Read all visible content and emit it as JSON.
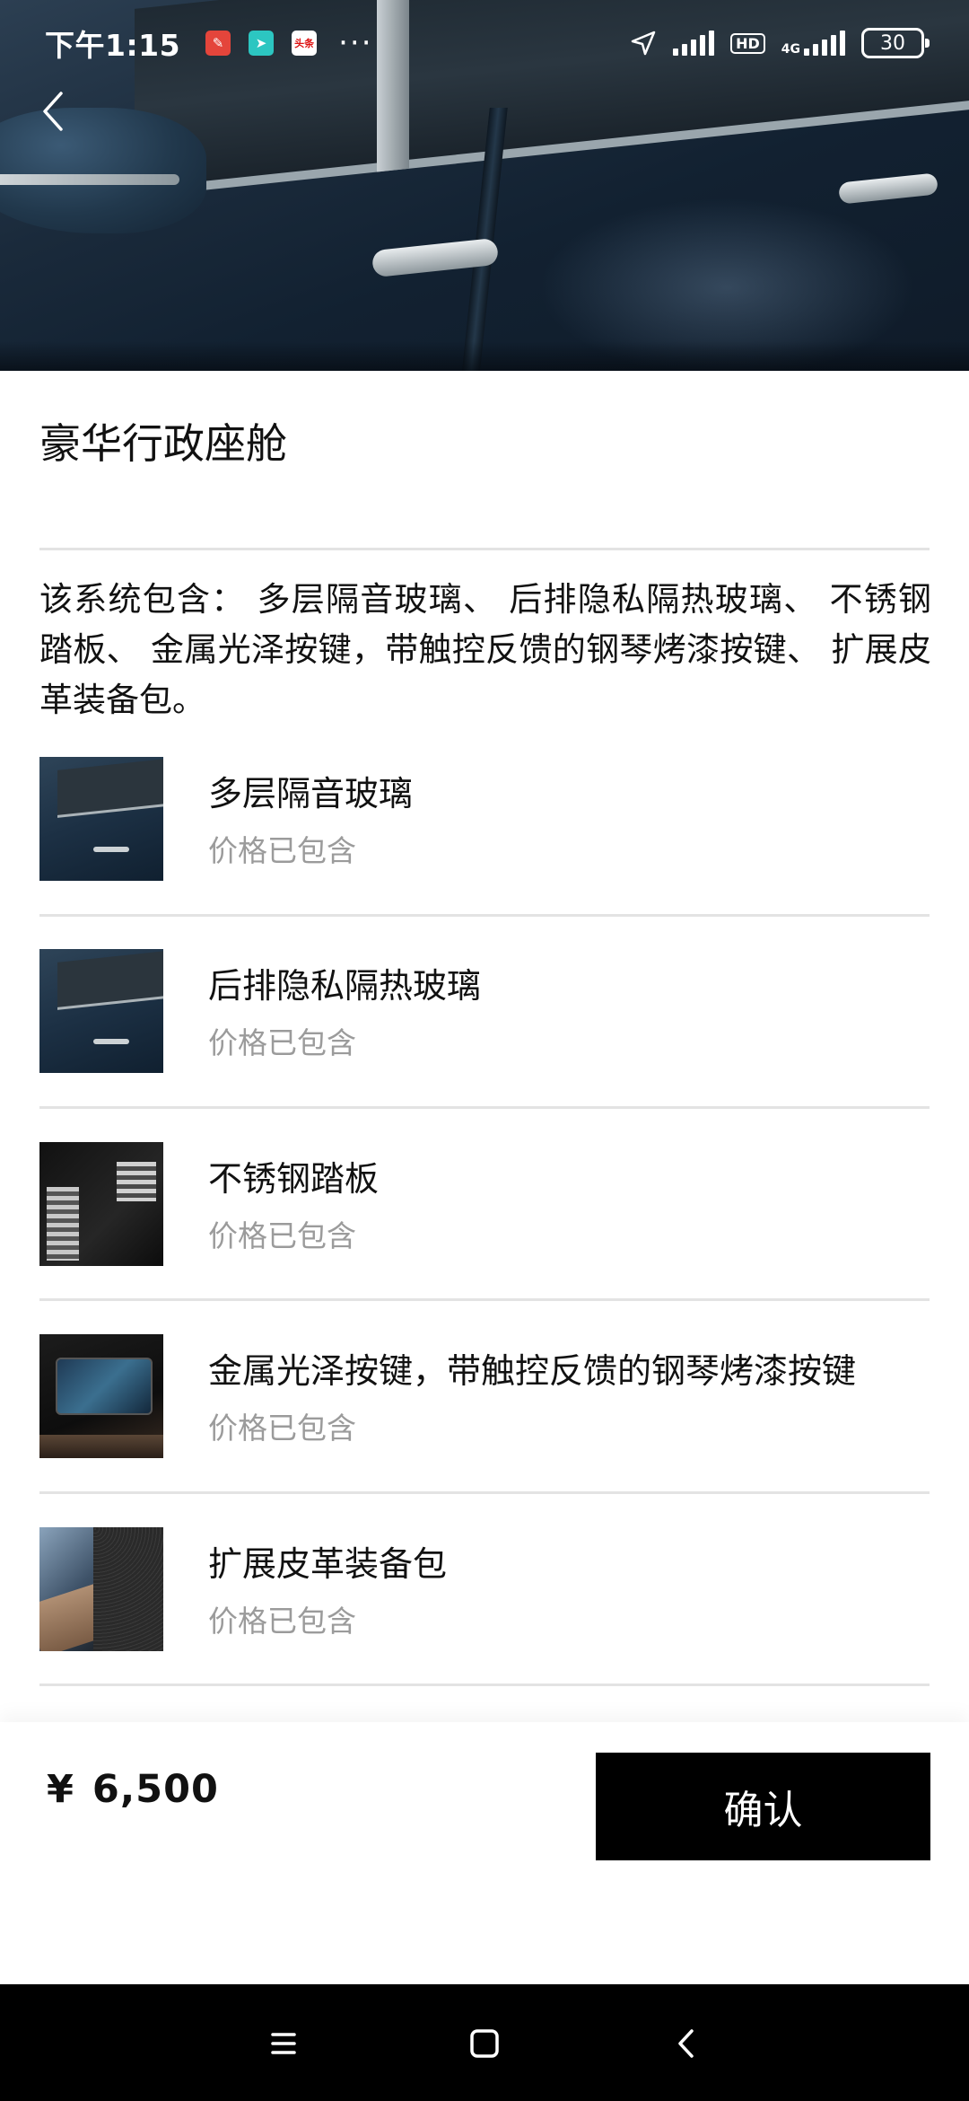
{
  "status_bar": {
    "time": "下午1:15",
    "notification_icons": [
      "notes-app-icon",
      "send-app-icon",
      "news-app-icon"
    ],
    "news_icon_text": "头条",
    "overflow": "···",
    "hd": "HD",
    "network": "4G",
    "battery": "30"
  },
  "hero": {
    "image": "car-door-side-photo"
  },
  "page": {
    "title": "豪华行政座舱",
    "description": "该系统包含： 多层隔音玻璃、 后排隐私隔热玻璃、 不锈钢踏板、 金属光泽按键，带触控反馈的钢琴烤漆按键、 扩展皮革装备包。"
  },
  "items": [
    {
      "name": "多层隔音玻璃",
      "status": "价格已包含",
      "thumb": "car-window-photo"
    },
    {
      "name": "后排隐私隔热玻璃",
      "status": "价格已包含",
      "thumb": "car-window-photo"
    },
    {
      "name": "不锈钢踏板",
      "status": "价格已包含",
      "thumb": "pedals-photo"
    },
    {
      "name": "金属光泽按键，带触控反馈的钢琴烤漆按键",
      "status": "价格已包含",
      "thumb": "console-photo"
    },
    {
      "name": "扩展皮革装备包",
      "status": "价格已包含",
      "thumb": "leather-door-photo"
    }
  ],
  "footer": {
    "currency": "¥",
    "price": "6,500",
    "confirm_label": "确认"
  },
  "colors": {
    "primary_button": "#000000",
    "muted_text": "#9b9b9b",
    "divider": "#e3e3e3"
  }
}
